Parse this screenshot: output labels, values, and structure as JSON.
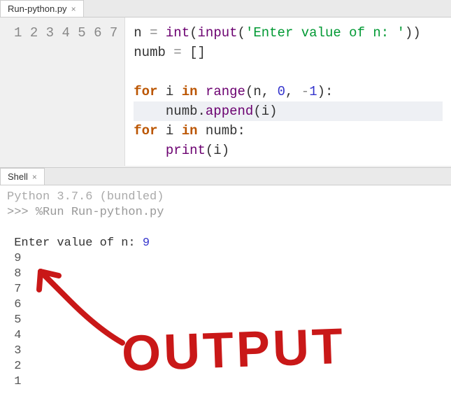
{
  "editor": {
    "tab_label": "Run-python.py",
    "line_numbers": [
      "1",
      "2",
      "3",
      "4",
      "5",
      "6",
      "7"
    ],
    "code": {
      "l1_var": "n ",
      "l1_eq": "=",
      "l1_sp": " ",
      "l1_int": "int",
      "l1_p1": "(",
      "l1_input": "input",
      "l1_p2": "(",
      "l1_str": "'Enter value of n: '",
      "l1_p3": "))",
      "l2_var": "numb ",
      "l2_eq": "=",
      "l2_val": " []",
      "l3": "",
      "l4_for": "for",
      "l4_mid": " i ",
      "l4_in": "in",
      "l4_sp": " ",
      "l4_range": "range",
      "l4_p1": "(n, ",
      "l4_z": "0",
      "l4_c": ", ",
      "l4_m": "-",
      "l4_one": "1",
      "l4_p2": "):",
      "l5_ind": "    numb.",
      "l5_append": "append",
      "l5_p": "(i)",
      "l6_for": "for",
      "l6_mid": " i ",
      "l6_in": "in",
      "l6_rest": " numb:",
      "l7_ind": "    ",
      "l7_print": "print",
      "l7_p": "(i)"
    }
  },
  "shell": {
    "tab_label": "Shell",
    "version": "Python 3.7.6 (bundled)",
    "prompt": ">>> ",
    "command": "%Run Run-python.py",
    "input_label": "Enter value of n: ",
    "input_value": "9",
    "output": [
      "9",
      "8",
      "7",
      "6",
      "5",
      "4",
      "3",
      "2",
      "1"
    ]
  },
  "annotation": {
    "text": "OUTPUT"
  }
}
